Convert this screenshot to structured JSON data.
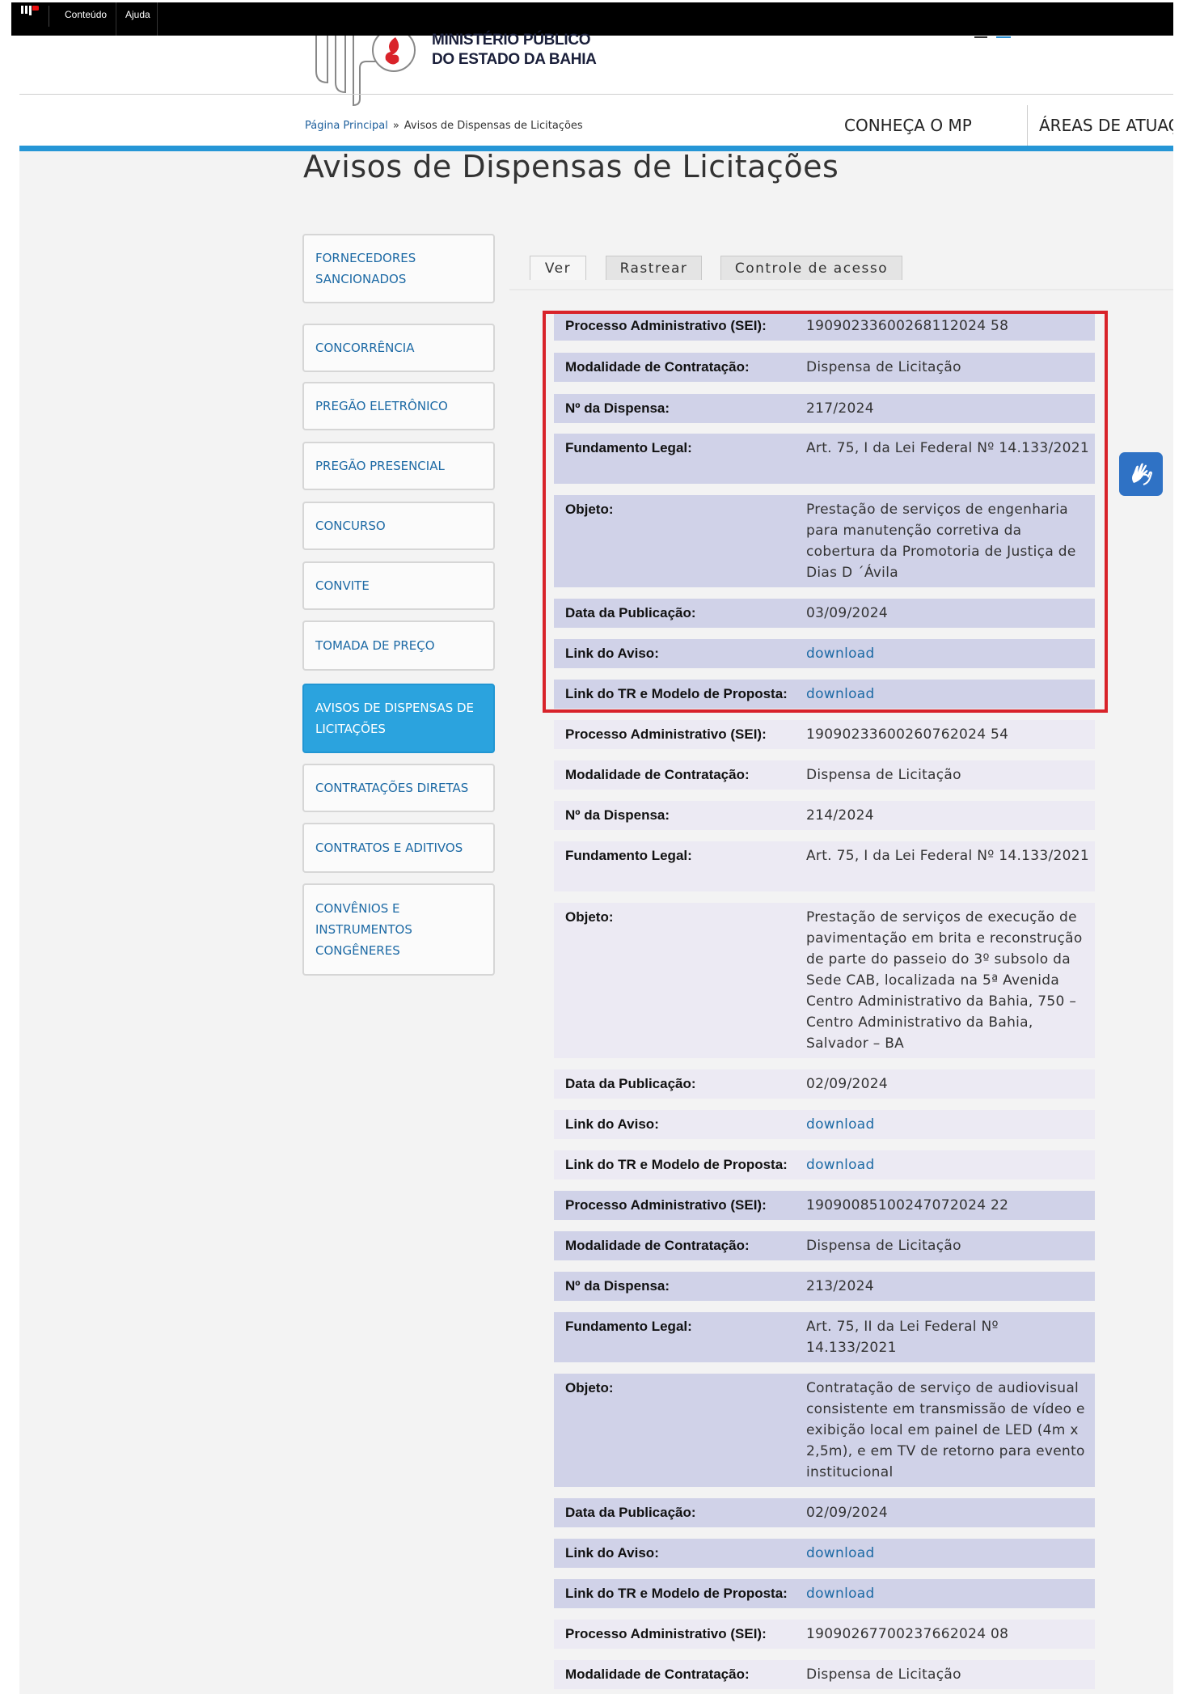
{
  "topbar": {
    "conteudo": "Conteúdo",
    "ajuda": "Ajuda"
  },
  "brand": {
    "line1": "MINISTÉRIO PÚBLICO",
    "line2": "DO ESTADO DA BAHIA"
  },
  "breadcrumb": {
    "home": "Página Principal",
    "sep": "»",
    "current": "Avisos de Dispensas de Licitações"
  },
  "nav": {
    "conheca": "CONHEÇA O MP",
    "areas": "ÁREAS DE ATUAÇÃO"
  },
  "page_title": "Avisos de Dispensas de Licitações",
  "sidebar": [
    "FORNECEDORES SANCIONADOS",
    "CONCORRÊNCIA",
    "PREGÃO ELETRÔNICO",
    "PREGÃO PRESENCIAL",
    "CONCURSO",
    "CONVITE",
    "TOMADA DE PREÇO",
    "AVISOS DE DISPENSAS DE LICITAÇÕES",
    "CONTRATAÇÕES DIRETAS",
    "CONTRATOS E ADITIVOS",
    "CONVÊNIOS E INSTRUMENTOS CONGÊNERES"
  ],
  "sidebar_active_index": 7,
  "tabs": [
    "Ver",
    "Rastrear",
    "Controle de acesso"
  ],
  "labels": {
    "processo": "Processo Administrativo (SEI):",
    "modalidade": "Modalidade de Contratação:",
    "dispensa": "Nº da Dispensa:",
    "fundamento": "Fundamento Legal:",
    "objeto": "Objeto:",
    "data": "Data da Publicação:",
    "link_aviso": "Link do Aviso:",
    "link_tr": "Link do TR e Modelo de Proposta:"
  },
  "records": [
    {
      "processo": "19090233600268112024 58",
      "modalidade": "Dispensa de Licitação",
      "dispensa": "217/2024",
      "fundamento": "Art. 75, I da Lei Federal Nº 14.133/2021",
      "objeto": "Prestação de serviços de engenharia para manutenção corretiva da cobertura da Promotoria de Justiça de Dias D ´Ávila",
      "data": "03/09/2024",
      "link_aviso": "download",
      "link_tr": "download"
    },
    {
      "processo": "19090233600260762024 54",
      "modalidade": "Dispensa de Licitação",
      "dispensa": "214/2024",
      "fundamento": "Art. 75, I da Lei Federal Nº 14.133/2021",
      "objeto": "Prestação de serviços de execução de pavimentação em brita e reconstrução de parte do passeio do 3º subsolo da Sede CAB, localizada na 5ª Avenida Centro Administrativo da Bahia, 750 – Centro Administrativo da Bahia, Salvador – BA",
      "data": "02/09/2024",
      "link_aviso": "download",
      "link_tr": "download"
    },
    {
      "processo": "19090085100247072024 22",
      "modalidade": "Dispensa de Licitação",
      "dispensa": "213/2024",
      "fundamento": "Art. 75, II da Lei Federal Nº 14.133/2021",
      "objeto": "Contratação de serviço de audiovisual consistente em transmissão de vídeo e exibição local em painel de LED (4m x 2,5m), e em TV de retorno para evento institucional",
      "data": "02/09/2024",
      "link_aviso": "download",
      "link_tr": "download"
    },
    {
      "processo": "19090267700237662024 08",
      "modalidade": "Dispensa de Licitação"
    }
  ]
}
